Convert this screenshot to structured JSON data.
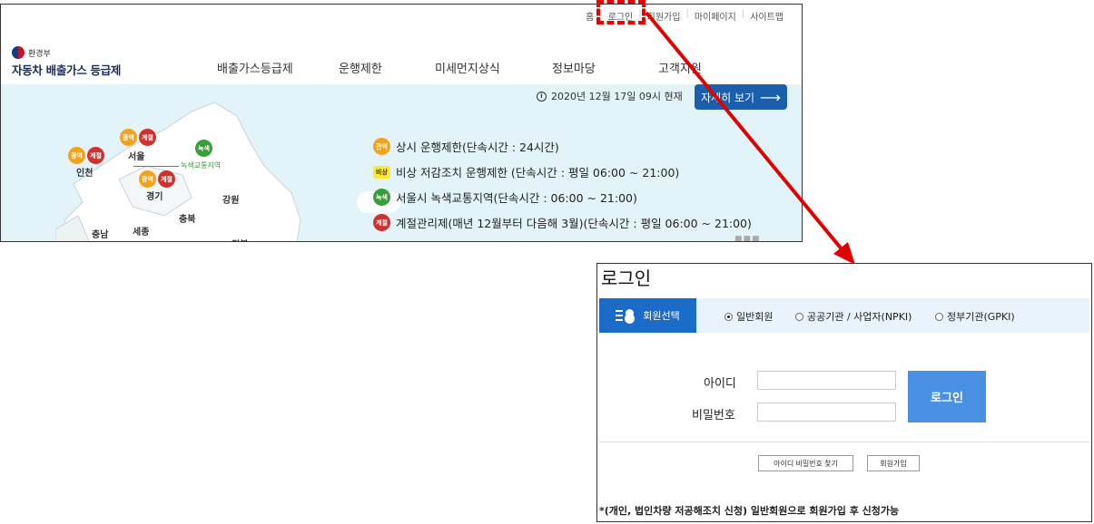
{
  "site": {
    "util_links": [
      "홈",
      "로그인",
      "회원가입",
      "마이페이지",
      "사이트맵"
    ],
    "ministry": "환경부",
    "brand": "자동차 배출가스 등급제",
    "menu": [
      "배출가스등급제",
      "운행제한",
      "미세먼지상식",
      "정보마당",
      "고객지원"
    ],
    "date_text": "2020년 12월 17일 09시 현재",
    "detail_button": "자세히 보기",
    "legend": [
      {
        "badge": "관역",
        "text": "상시 운행제한(단속시간 : 24시간)",
        "color": "#f2a31b"
      },
      {
        "badge": "비상",
        "text": "비상 저감조치 운행제한 (단속시간 : 평일 06:00 ~ 21:00)",
        "color": "#ffe733"
      },
      {
        "badge": "녹색",
        "text": "서울시 녹색교통지역(단속시간 : 06:00 ~ 21:00)",
        "color": "#3a9d3a"
      },
      {
        "badge": "계절",
        "text": "계절관리제(매년 12월부터 다음해 3월)(단속시간 : 평일 06:00 ~ 21:00)",
        "color": "#d0312d"
      }
    ],
    "map": {
      "regions": [
        "서울",
        "인천",
        "경기",
        "강원",
        "충북",
        "충남",
        "세종",
        "경북"
      ],
      "green_zone_label": "녹색교통지역",
      "badge_gwang": "광역",
      "badge_gye": "계절",
      "badge_green": "녹색"
    }
  },
  "login": {
    "title": "로그인",
    "member_select": "회원선택",
    "member_types": [
      "일반회원",
      "공공기관 / 사업자(NPKI)",
      "정부기관(GPKI)"
    ],
    "selected_member_type": "일반회원",
    "id_label": "아이디",
    "password_label": "비밀번호",
    "id_value": "",
    "password_value": "",
    "login_button": "로그인",
    "find_button": "아이디 비밀번호 찾기",
    "signup_button": "회원가입",
    "note": "*(개인, 법인차량 저공해조치 신청) 일반회원으로 회원가입 후 신청가능"
  },
  "colors": {
    "accent_blue": "#1b5eab",
    "login_blue": "#4a90e2",
    "callout_red": "#e00000",
    "hero_bg": "#e2f3fa"
  }
}
